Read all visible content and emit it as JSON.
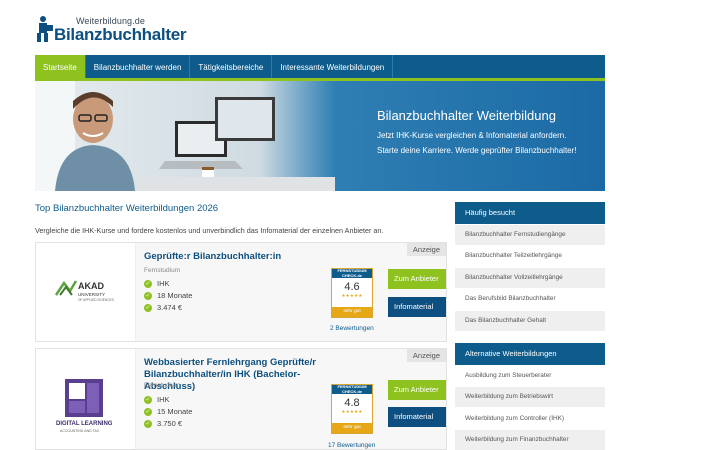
{
  "logo": {
    "small": "Weiterbildung.de",
    "big": "Bilanzbuchhalter"
  },
  "nav": {
    "items": [
      {
        "label": "Startseite",
        "active": true
      },
      {
        "label": "Bilanzbuchhalter werden",
        "active": false
      },
      {
        "label": "Tätigkeitsbereiche",
        "active": false
      },
      {
        "label": "Interessante Weiterbildungen",
        "active": false
      }
    ]
  },
  "hero": {
    "title": "Bilanzbuchhalter Weiterbildung",
    "line1": "Jetzt IHK-Kurse vergleichen & Infomaterial anfordern.",
    "line2": "Starte deine Karriere. Werde geprüfter Bilanzbuchhalter!"
  },
  "main": {
    "title": "Top Bilanzbuchhalter Weiterbildungen 2026",
    "intro": "Vergleiche die IHK-Kurse und fordere kostenlos und unverbindlich das Infomaterial der einzelnen Anbieter an.",
    "cards": [
      {
        "badge": "Anzeige",
        "provider_logo": "AKAD",
        "provider_logo_sub1": "UNIVERSITY",
        "provider_logo_sub2": "OF APPLIED SCIENCES",
        "title": "Geprüfte:r Bilanzbuchhalter:in",
        "type": "Fernstudium",
        "features": [
          "IHK",
          "18 Monate",
          "3.474 €"
        ],
        "seal_top": "FERNSTUDIUM CHECK.de",
        "score": "4.6",
        "seal_label": "sehr gut",
        "reviews": "2 Bewertungen",
        "btn_provider": "Zum Anbieter",
        "btn_info": "Infomaterial"
      },
      {
        "badge": "Anzeige",
        "provider_logo": "DIGITAL LEARNING",
        "provider_logo_sub1": "ACCOUNTING AND TAX",
        "title": "Webbasierter Fernlehrgang Geprüfte/r Bilanzbuchhalter/in IHK (Bachelor-Abschluss)",
        "type": "Fernstudium",
        "features": [
          "IHK",
          "15 Monate",
          "3.750 €"
        ],
        "seal_top": "FERNSTUDIUM CHECK.de",
        "score": "4.8",
        "seal_label": "sehr gut",
        "reviews": "17 Bewertungen",
        "btn_provider": "Zum Anbieter",
        "btn_info": "Infomaterial"
      }
    ]
  },
  "sidebar": {
    "section1": {
      "title": "Häufig besucht",
      "items": [
        "Bilanzbuchhalter Fernstudiengänge",
        "Bilanzbuchhalter Teilzeitlehrgänge",
        "Bilanzbuchhalter Vollzeitlehrgänge",
        "Das Berufsbild Bilanzbuchhalter",
        "Das Bilanzbuchhalter Gehalt"
      ]
    },
    "section2": {
      "title": "Alternative Weiterbildungen",
      "items": [
        "Ausbildung zum Steuerberater",
        "Weiterbildung zum Betriebswirt",
        "Weiterbildung zum Controller (IHK)",
        "Weiterbildung zum Finanzbuchhalter"
      ]
    }
  },
  "colors": {
    "brand_blue": "#0d5c8c",
    "accent_green": "#8dc21f",
    "seal_gold": "#e6a817"
  }
}
